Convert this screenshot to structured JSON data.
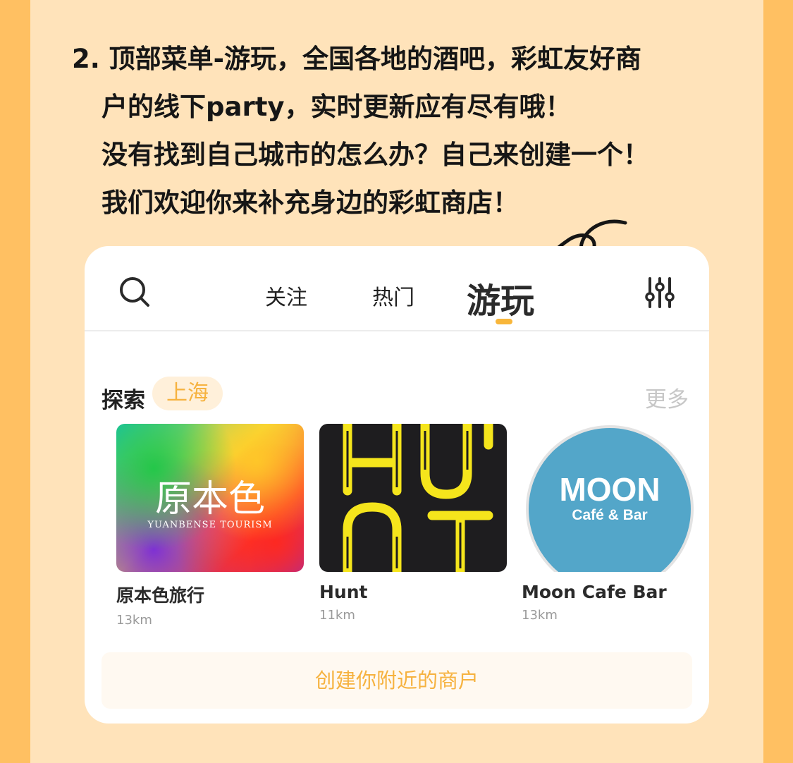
{
  "intro": {
    "line1": "2. 顶部菜单-游玩，全国各地的酒吧，彩虹友好商",
    "line2": "户的线下party，实时更新应有尽有哦！",
    "line3": "没有找到自己城市的怎么办？自己来创建一个！",
    "line4": "我们欢迎你来补充身边的彩虹商店！"
  },
  "topbar": {
    "search_icon": "search-icon",
    "filter_icon": "sliders-icon",
    "tabs": [
      {
        "label": "关注"
      },
      {
        "label": "热门"
      },
      {
        "label": "游玩",
        "active": true
      }
    ]
  },
  "explore": {
    "title": "探索",
    "city": "上海",
    "more": "更多"
  },
  "venues": [
    {
      "name": "原本色旅行",
      "distance": "13km",
      "logo_text": "原本色",
      "logo_sub": "YUANBENSE TOURISM"
    },
    {
      "name": "Hunt",
      "distance": "11km",
      "logo_text": "HUNT"
    },
    {
      "name": "Moon Cafe Bar",
      "distance": "13km",
      "logo_text": "MOON",
      "logo_sub": "Café & Bar"
    }
  ],
  "create_button": "创建你附近的商户",
  "colors": {
    "page_bg": "#FFC062",
    "panel_bg": "#FFE3BA",
    "accent": "#F6B23F",
    "card_bg": "#FFFFFF"
  }
}
